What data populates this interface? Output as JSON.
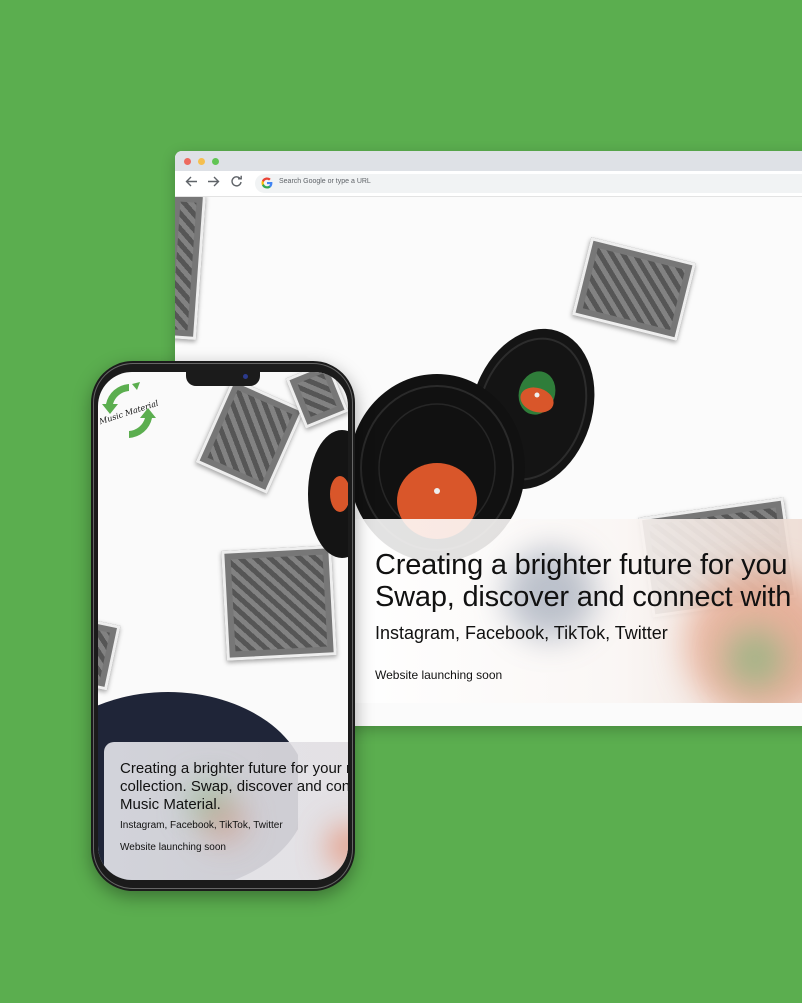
{
  "browser": {
    "search_placeholder": "Search Google or type a URL",
    "traffic_lights": [
      "#ed6a5e",
      "#f5bf4f",
      "#61c554"
    ],
    "icons": {
      "back": "back-arrow-icon",
      "forward": "forward-arrow-icon",
      "reload": "reload-icon",
      "search_engine": "google-g-icon"
    }
  },
  "desktop_hero": {
    "headline_line1": "Creating a brighter future for you",
    "headline_line2": "Swap, discover and connect with",
    "social": "Instagram, Facebook, TikTok, Twitter",
    "launch": "Website launching soon"
  },
  "mobile_hero": {
    "headline_line1": "Creating a brighter future for your r",
    "headline_line2": "collection. Swap, discover and con",
    "headline_line3": "Music Material.",
    "social": "Instagram, Facebook, TikTok, Twitter",
    "launch": "Website launching soon"
  },
  "logo": {
    "text": "Music Material",
    "color": "#5bae4f"
  },
  "colors": {
    "background": "#5bae4f",
    "accent": "#5bae4f",
    "label_orange": "#d9562a",
    "label_green": "#2f7d3a"
  }
}
